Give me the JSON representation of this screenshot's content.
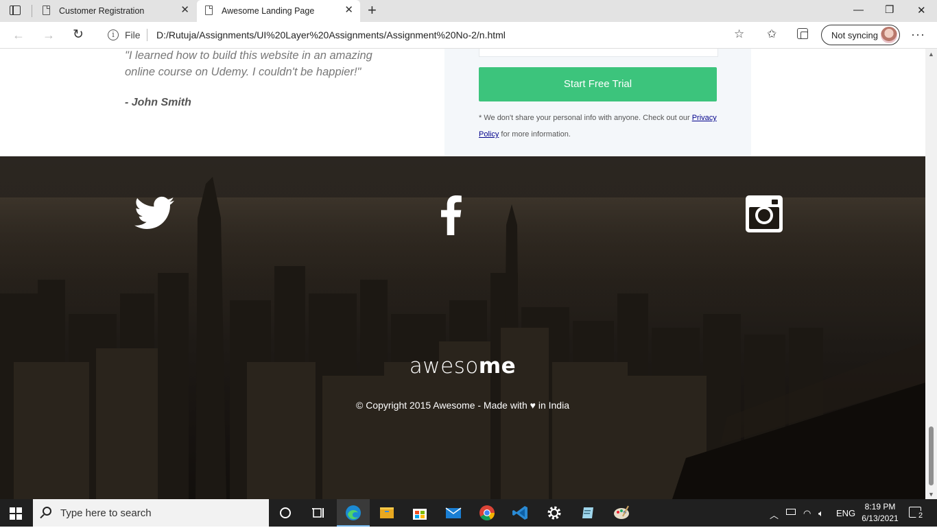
{
  "browser": {
    "tabs": [
      {
        "label": "Customer Registration",
        "active": false
      },
      {
        "label": "Awesome Landing Page",
        "active": true
      }
    ],
    "address": {
      "scheme_label": "File",
      "url": "D:/Rutuja/Assignments/UI%20Layer%20Assignments/Assignment%20No-2/n.html"
    },
    "sync_label": "Not syncing"
  },
  "page": {
    "testimonial": {
      "quote": "\"I learned how to build this website in an amazing online course on Udemy. I couldn't be happier!\"",
      "author": "- John Smith"
    },
    "signup": {
      "button_label": "Start Free Trial",
      "privacy_prefix": "* We don't share your personal info with anyone. Check out our ",
      "privacy_link": "Privacy Policy",
      "privacy_suffix": " for more information.",
      "button_color": "#3cc47c"
    },
    "footer": {
      "social": [
        "twitter-icon",
        "facebook-icon",
        "instagram-icon"
      ],
      "logo_light": "aweso",
      "logo_bold": "me",
      "copyright": "© Copyright 2015 Awesome - Made with ♥ in India"
    }
  },
  "taskbar": {
    "search_placeholder": "Type here to search",
    "language": "ENG",
    "time": "8:19 PM",
    "date": "6/13/2021",
    "notification_count": "2"
  }
}
